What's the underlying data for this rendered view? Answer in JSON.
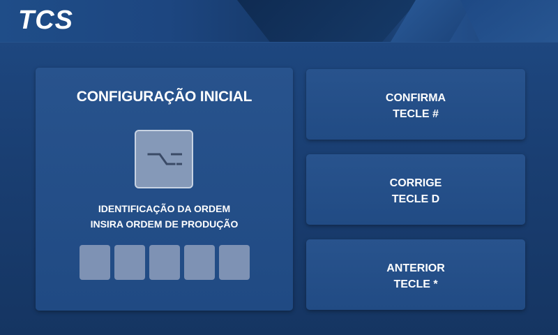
{
  "header": {
    "logo_text": "TCS"
  },
  "setup_panel": {
    "title": "CONFIGURAÇÃO INICIAL",
    "icon": "order-switch-icon",
    "instruction_line1": "IDENTIFICAÇÃO DA ORDEM",
    "instruction_line2": "INSIRA ORDEM DE PRODUÇÃO",
    "digit_slots": [
      "",
      "",
      "",
      "",
      ""
    ]
  },
  "buttons": {
    "confirm": {
      "label": "CONFIRMA",
      "key_hint": "TECLE #"
    },
    "correct": {
      "label": "CORRIGE",
      "key_hint": "TECLE D"
    },
    "previous": {
      "label": "ANTERIOR",
      "key_hint": "TECLE *"
    }
  },
  "colors": {
    "background": "#1a3f73",
    "panel": "#24508a",
    "digit_slot": "#7e92b4",
    "text": "#ffffff"
  }
}
